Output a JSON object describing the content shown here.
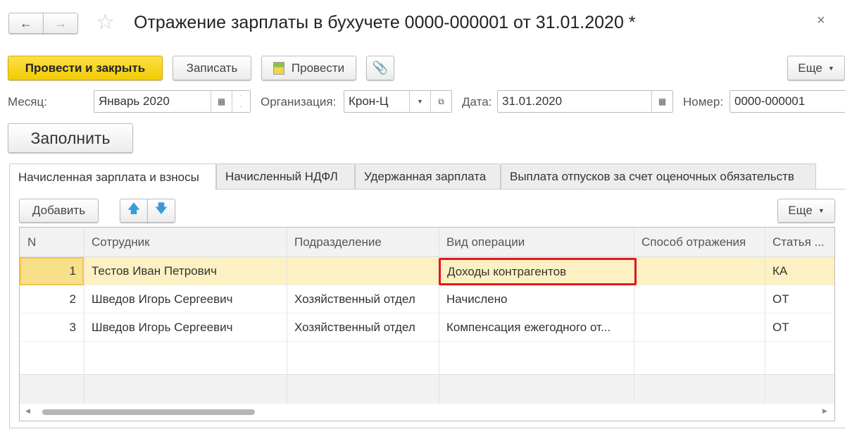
{
  "title": "Отражение зарплаты в бухучете 0000-000001 от 31.01.2020 *",
  "toolbar": {
    "post_close": "Провести и закрыть",
    "save": "Записать",
    "post": "Провести",
    "more": "Еще"
  },
  "fields": {
    "month_label": "Месяц:",
    "month_value": "Январь 2020",
    "org_label": "Организация:",
    "org_value": "Крон-Ц",
    "date_label": "Дата:",
    "date_value": "31.01.2020",
    "number_label": "Номер:",
    "number_value": "0000-000001"
  },
  "fill": "Заполнить",
  "tabs": [
    {
      "label": "Начисленная зарплата и взносы",
      "active": true
    },
    {
      "label": "Начисленный НДФЛ"
    },
    {
      "label": "Удержанная зарплата"
    },
    {
      "label": "Выплата отпусков за счет оценочных обязательств"
    }
  ],
  "table_toolbar": {
    "add": "Добавить",
    "more": "Еще"
  },
  "table": {
    "columns": [
      "N",
      "Сотрудник",
      "Подразделение",
      "Вид операции",
      "Способ отражения",
      "Статья ..."
    ],
    "rows": [
      [
        "1",
        "Тестов Иван Петрович",
        "",
        "Доходы контрагентов",
        "",
        "КА"
      ],
      [
        "2",
        "Шведов Игорь Сергеевич",
        "Хозяйственный отдел",
        "Начислено",
        "",
        "ОТ"
      ],
      [
        "3",
        "Шведов Игорь Сергеевич",
        "Хозяйственный отдел",
        "Компенсация ежегодного от...",
        "",
        "ОТ"
      ]
    ]
  },
  "colors": {
    "accent_button": "#f7d51d",
    "selected_row": "#fdf1c4",
    "highlight_border": "#e01a1a"
  }
}
